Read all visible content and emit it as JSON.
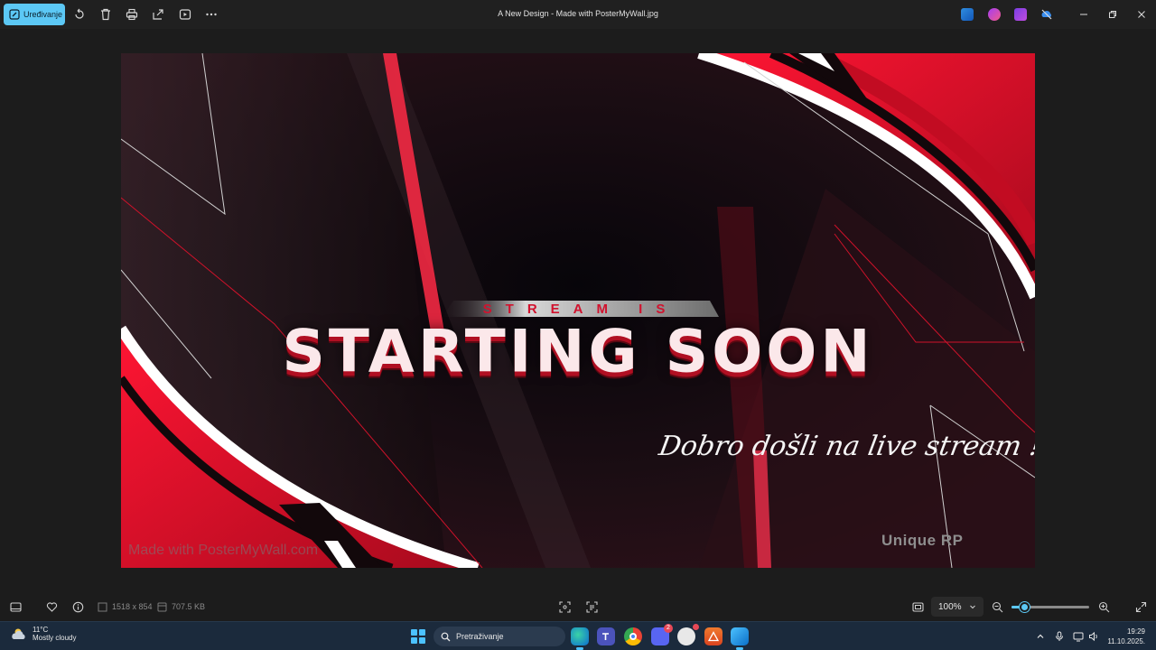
{
  "toolbar": {
    "edit_label": "Uređivanje",
    "title": "A New Design - Made with PosterMyWall.jpg"
  },
  "poster": {
    "subtitle": "STREAM IS",
    "headline": "STARTING SOON",
    "welcome": "Dobro došli na live stream !",
    "brand": "Unique RP",
    "watermark": "Made with PosterMyWall.com"
  },
  "statusbar": {
    "dimensions": "1518 x 854",
    "file_size": "707.5 KB",
    "zoom_value": "100%",
    "zoom_fraction": 0.17
  },
  "taskbar": {
    "temperature": "11°C",
    "weather": "Mostly cloudy",
    "search_placeholder": "Pretraživanje",
    "discord_badge": "2",
    "time": "19:29",
    "date": "11.10.2025."
  },
  "colors": {
    "accent": "#5cc8f5",
    "poster_red": "#e0102a",
    "taskbar": "#1b2a3c"
  }
}
